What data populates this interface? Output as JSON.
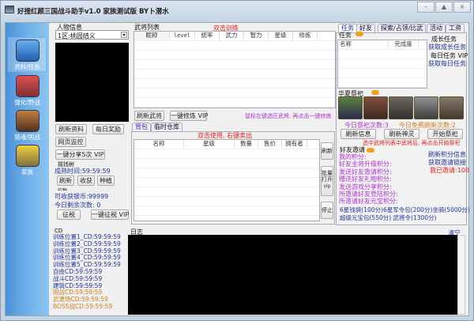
{
  "window": {
    "title": "好搜红颜三国战斗助手v1.0 家族测试版 BY卜潜水",
    "controls": [
      "–",
      "▲",
      "×"
    ]
  },
  "sidebar": {
    "items": [
      {
        "label": "资料/任务",
        "icon": "home-icon"
      },
      {
        "label": "强化/野战",
        "icon": "heroes-icon"
      },
      {
        "label": "猎魂/国战",
        "icon": "battle-icon"
      },
      {
        "label": "家族",
        "icon": "family-icon"
      }
    ]
  },
  "person": {
    "title": "人物信息",
    "server": "1区:桃园结义",
    "buttons": {
      "refresh": "刷新资料",
      "daily": "每日奖励",
      "monitor": "网页监控",
      "share": "一键分享5次 VIP"
    },
    "tree": {
      "title": "摇钱树",
      "mature": "成熟时间:59:59:59",
      "refresh": "刷新",
      "harvest": "收获",
      "plant": "种植"
    },
    "tax": {
      "title": "征税",
      "silver": "可收获银币:99999",
      "remain": "今日剩余次数: 0",
      "tax": "征税",
      "onekey": "一键征税 VIP"
    }
  },
  "generals": {
    "title": "武将列表",
    "hint": "双击训练",
    "columns": [
      "昵称",
      "level",
      "统率",
      "武力",
      "智力",
      "星级",
      "修炼"
    ],
    "refresh": "刷新武将",
    "train": "一键修炼 VIP",
    "tip": "鼠标左键选区武将, 再点击一键修炼"
  },
  "bag": {
    "tabs": [
      "背包",
      "临时仓库"
    ],
    "hint": "双击使用, 右键卖出",
    "columns": [
      "名称",
      "星级",
      "数量",
      "售价",
      "拥有者"
    ],
    "refresh": "刷新",
    "batch": "批量打开",
    "vip": "vip",
    "stop": "停止"
  },
  "right": {
    "tabs": [
      "任务",
      "好友",
      "探索/占领/比武",
      "活动",
      "工资"
    ],
    "task": {
      "title": "任务",
      "columns": [
        "名称",
        "完成度"
      ],
      "growth": "成长任务",
      "get_growth": "获取成长任务",
      "daily": "每日任务 VIP",
      "get_daily": "获取每日任务"
    },
    "sacrifice": {
      "title": "华夏祭祀",
      "count": "今日祭祀次数:3",
      "free": "今日免费刷新次数:2",
      "refresh_info": "刷新信息",
      "refresh_god": "刷新神灵",
      "start": "开始祭祀",
      "tip": "选中武将列表中武将后, 再点击开始祭祀"
    },
    "invite": {
      "title": "好友邀请",
      "lines": [
        "我的积分:",
        "好友主将升级积分:",
        "发送好友邀请积分:",
        "赠送好友礼物积分:",
        "发送游戏分享积分:",
        "所邀请好友登陆积分:",
        "所邀请好友元宝积分:"
      ],
      "refresh": "刷新积分信息",
      "link": "获取邀请链接",
      "invited": "我已邀请:100",
      "rewards1": "6星钱袋(100分)6星军令包(200分)坐骑(5000分)",
      "rewards2": "超级元宝包(550分) 武将令(1300分)"
    }
  },
  "cd": {
    "title": "CD",
    "lines": [
      "训练位置1_CD:59:59:59",
      "训练位置2_CD:59:59:59",
      "训练位置3_CD:59:59:59",
      "训练位置4_CD:59:59:59",
      "训练位置5_CD:59:59:59",
      "自由CD:59:59:59",
      "战斗CD:59:59:59",
      "建筑CD:59:59:59",
      "国战CD:59:59:59",
      "武遭场CD:59:59:59",
      "BOSS战CD:59:59:59"
    ]
  },
  "log": {
    "title": "日志",
    "clear": "清空"
  },
  "colors": {
    "sidebar": "#4a90d9",
    "red": "#e02020",
    "purple": "#b030d0",
    "navy": "#223399",
    "orange": "#d08020"
  }
}
